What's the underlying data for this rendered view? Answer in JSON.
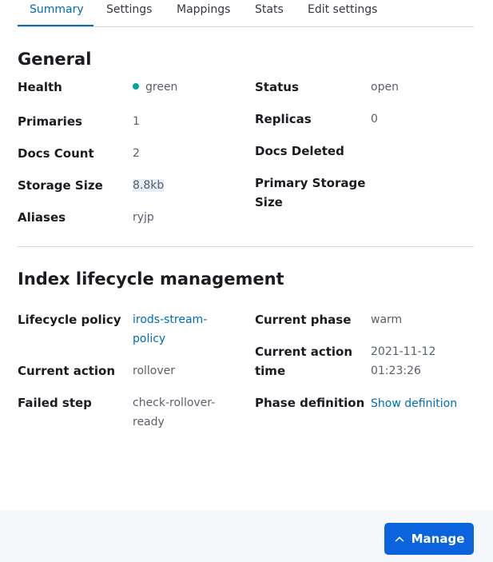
{
  "tabs": [
    {
      "label": "Summary",
      "active": true
    },
    {
      "label": "Settings"
    },
    {
      "label": "Mappings"
    },
    {
      "label": "Stats"
    },
    {
      "label": "Edit settings"
    }
  ],
  "general": {
    "title": "General",
    "health_label": "Health",
    "health_value": "green",
    "health_color": "#00a69b",
    "status_label": "Status",
    "status_value": "open",
    "primaries_label": "Primaries",
    "primaries_value": "1",
    "replicas_label": "Replicas",
    "replicas_value": "0",
    "docs_count_label": "Docs Count",
    "docs_count_value": "2",
    "docs_deleted_label": "Docs Deleted",
    "storage_size_label": "Storage Size",
    "storage_size_value": "8.8kb",
    "primary_storage_label_line1": "Primary Storage",
    "primary_storage_label_line2": "Size",
    "aliases_label": "Aliases",
    "aliases_value": "ryjp"
  },
  "ilm": {
    "title": "Index lifecycle management",
    "policy_label": "Lifecycle policy",
    "policy_value_line1": "irods-stream-",
    "policy_value_line2": "policy",
    "phase_label": "Current phase",
    "phase_value": "warm",
    "action_time_label_line1": "Current action",
    "action_time_label_line2": "time",
    "action_time_value_line1": "2021-11-12",
    "action_time_value_line2": "01:23:26",
    "action_label": "Current action",
    "action_value": "rollover",
    "failed_step_label": "Failed step",
    "failed_step_value_line1": "check-rollover-",
    "failed_step_value_line2": "ready",
    "phase_def_label": "Phase definition",
    "phase_def_link": "Show definition"
  },
  "footer": {
    "manage_label": "Manage"
  }
}
